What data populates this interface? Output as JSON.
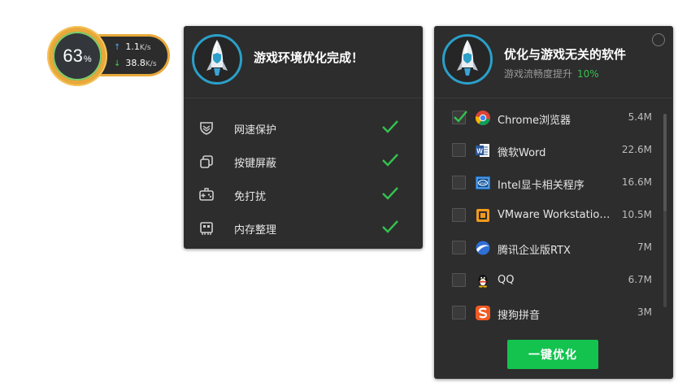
{
  "speed_ball": {
    "percent": "63",
    "percent_unit": "%",
    "upload_value": "1.1",
    "upload_unit": "K/s",
    "download_value": "38.8",
    "download_unit": "K/s",
    "up_arrow": "↑",
    "down_arrow": "↓"
  },
  "panel_done": {
    "title": "游戏环境优化完成！",
    "items": [
      {
        "label": "网速保护",
        "icon": "shield-icon"
      },
      {
        "label": "按键屏蔽",
        "icon": "key-block-icon"
      },
      {
        "label": "免打扰",
        "icon": "gamepad-icon"
      },
      {
        "label": "内存整理",
        "icon": "memory-icon"
      }
    ]
  },
  "panel_apps": {
    "title": "优化与游戏无关的软件",
    "subtitle": "游戏流畅度提升",
    "subtitle_percent": "10%",
    "apps": [
      {
        "name": "Chrome浏览器",
        "size": "5.4M",
        "checked": true,
        "icon": "chrome-icon"
      },
      {
        "name": "微软Word",
        "size": "22.6M",
        "checked": false,
        "icon": "word-icon"
      },
      {
        "name": "Intel显卡相关程序",
        "size": "16.6M",
        "checked": false,
        "icon": "intel-icon"
      },
      {
        "name": "VMware Workstation Pro",
        "size": "10.5M",
        "checked": false,
        "icon": "vmware-icon"
      },
      {
        "name": "腾讯企业版RTX",
        "size": "7M",
        "checked": false,
        "icon": "rtx-icon"
      },
      {
        "name": "QQ",
        "size": "6.7M",
        "checked": false,
        "icon": "qq-penguin-icon"
      },
      {
        "name": "搜狗拼音",
        "size": "3M",
        "checked": false,
        "icon": "sogou-icon"
      }
    ],
    "optimize_button": "一键优化"
  },
  "colors": {
    "accent_green": "#13c34e",
    "panel_bg": "#2d2d2d",
    "ball_ring": "#e8a93a",
    "logo_ring": "#2b9fc9"
  }
}
